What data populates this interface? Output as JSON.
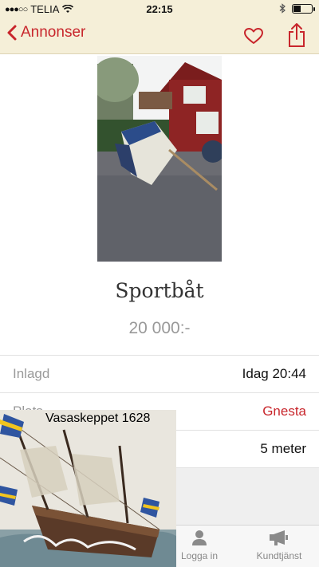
{
  "status_bar": {
    "carrier": "TELIA",
    "time": "22:15",
    "battery_level": 0.45
  },
  "nav": {
    "back_label": "Annonser",
    "accent_color": "#c8262c"
  },
  "listing": {
    "title": "Sportbåt",
    "price": "20 000:-",
    "details": [
      {
        "label": "Inlagd",
        "value": "Idag 20:44"
      },
      {
        "label": "Plats",
        "value": "Gnesta"
      },
      {
        "label": "",
        "value": "5 meter"
      }
    ]
  },
  "tabbar": {
    "items": [
      {
        "label": "Logga in",
        "icon": "person-icon"
      },
      {
        "label": "Kundtjänst",
        "icon": "megaphone-icon"
      }
    ]
  },
  "overlay": {
    "caption": "Vasaskeppet 1628"
  }
}
